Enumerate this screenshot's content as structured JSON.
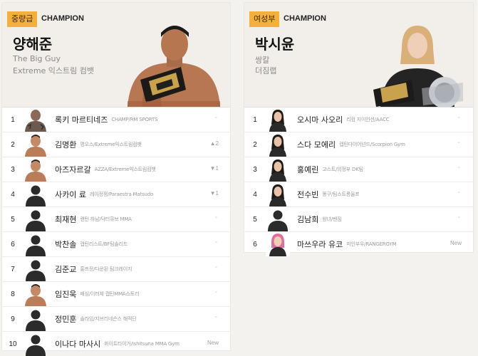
{
  "left": {
    "tag": "중량급",
    "subtitle": "CHAMPION",
    "champion": {
      "name": "양해준",
      "nickname": "The Big Guy",
      "gym": "Extreme 익스트림 컴뱃"
    },
    "rankings": [
      {
        "rank": "1",
        "name": "록키 마르티네즈",
        "gym": "CHAMP/RM SPORTS",
        "movement": "-",
        "avatar": "photo-tattoo"
      },
      {
        "rank": "2",
        "name": "김명환",
        "gym": "명오스/Extreme익스트림컴뱃",
        "movement": "▲2",
        "avatar": "photo-light"
      },
      {
        "rank": "3",
        "name": "아즈자르갈",
        "gym": "AZZA/Extreme익스트림컴뱃",
        "movement": "▼1",
        "avatar": "photo-light"
      },
      {
        "rank": "4",
        "name": "사카이 료",
        "gym": "레이정쟁/Paraestra Matsudo",
        "movement": "▼1",
        "avatar": "silhouette"
      },
      {
        "rank": "5",
        "name": "최재현",
        "gym": "랜턴 하남/닥터큐브 MMA",
        "movement": "-",
        "avatar": "silhouette"
      },
      {
        "rank": "6",
        "name": "박찬솔",
        "gym": "캡틴리스트/BF팀솔리드",
        "movement": "-",
        "avatar": "silhouette"
      },
      {
        "rank": "7",
        "name": "김준교",
        "gym": "홍프정/다운된 팀크레이지",
        "movement": "-",
        "avatar": "silhouette"
      },
      {
        "rank": "8",
        "name": "임진욱",
        "gym": "배심/이터체 캡틴MMA스토리",
        "movement": "-",
        "avatar": "photo-light"
      },
      {
        "rank": "9",
        "name": "정민훈",
        "gym": "솔라임/지브리네슨스 해적단",
        "movement": "-",
        "avatar": "silhouette"
      },
      {
        "rank": "10",
        "name": "이나다 마사시",
        "gym": "화이트타이거/Ishitsuna MMA Gym",
        "movement": "New",
        "avatar": "silhouette"
      }
    ]
  },
  "right": {
    "tag": "여성부",
    "subtitle": "CHAMPION",
    "champion": {
      "name": "박시윤",
      "nickname": "쌍칼",
      "gym": "더짐랩"
    },
    "rankings": [
      {
        "rank": "1",
        "name": "오시마 사오리",
        "gym": "리컴 지이얀션/AACC",
        "movement": "-",
        "avatar": "photo-woman"
      },
      {
        "rank": "2",
        "name": "스다 모에리",
        "gym": "캡틴다이어넌드/Scorpion Gym",
        "movement": "-",
        "avatar": "photo-woman"
      },
      {
        "rank": "3",
        "name": "홍예린",
        "gym": "고스트/의정부 DK팀",
        "movement": "-",
        "avatar": "photo-woman"
      },
      {
        "rank": "4",
        "name": "전수빈",
        "gym": "똥구/팀스트롱울프",
        "movement": "-",
        "avatar": "photo-woman"
      },
      {
        "rank": "5",
        "name": "김남희",
        "gym": "왕녀/벤짐",
        "movement": "-",
        "avatar": "silhouette"
      },
      {
        "rank": "6",
        "name": "마쓰우라 유코",
        "gym": "미인부우/RANGERGYM",
        "movement": "New",
        "avatar": "photo-pink"
      }
    ]
  },
  "colors": {
    "tag": "#f3b13c",
    "panel": "#ffffff",
    "page": "#f4f2ee"
  }
}
